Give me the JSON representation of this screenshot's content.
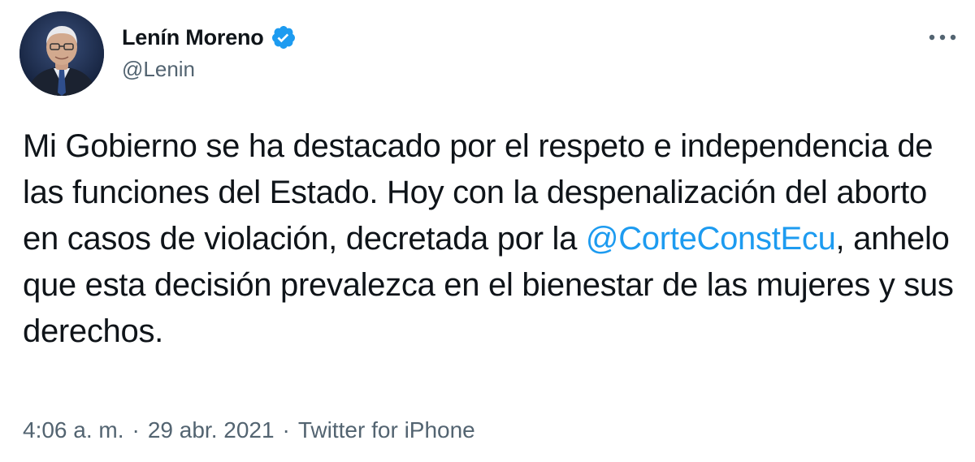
{
  "author": {
    "display_name": "Lenín Moreno",
    "handle": "@Lenin",
    "verified": true
  },
  "icons": {
    "verified": "verified-badge-icon",
    "more": "more-options-icon",
    "avatar": "profile-photo"
  },
  "colors": {
    "text": "#0f1419",
    "secondary": "#536471",
    "link": "#1d9bf0",
    "verified": "#1d9bf0"
  },
  "tweet": {
    "text_before_mention": "Mi Gobierno se ha destacado por el respeto e independencia de las funciones del Estado. Hoy con la despenalización del aborto en casos de violación, decretada por la ",
    "mention": "@CorteConstEcu",
    "text_after_mention": ", anhelo que esta decisión prevalezca en el bienestar de las mujeres y sus derechos."
  },
  "meta": {
    "time": "4:06 a. m.",
    "separator": "·",
    "date": "29 abr. 2021",
    "source": "Twitter for iPhone"
  }
}
